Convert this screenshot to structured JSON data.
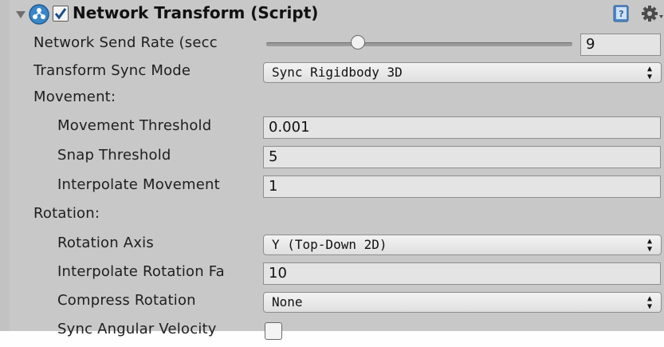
{
  "header": {
    "title": "Network Transform (Script)",
    "enabled": true
  },
  "send_rate": {
    "label": "Network Send Rate (secc",
    "value": "9",
    "slider_fraction": 0.3
  },
  "sync_mode": {
    "label": "Transform Sync Mode",
    "value": "Sync Rigidbody 3D"
  },
  "movement": {
    "heading": "Movement:",
    "threshold_label": "Movement Threshold",
    "threshold_value": "0.001",
    "snap_label": "Snap Threshold",
    "snap_value": "5",
    "interp_label": "Interpolate Movement",
    "interp_value": "1"
  },
  "rotation": {
    "heading": "Rotation:",
    "axis_label": "Rotation Axis",
    "axis_value": "Y (Top-Down 2D)",
    "interp_label": "Interpolate Rotation Fa",
    "interp_value": "10",
    "compress_label": "Compress Rotation",
    "compress_value": "None",
    "angular_label": "Sync Angular Velocity",
    "angular_checked": false
  },
  "colors": {
    "panel": "#c8c8c8",
    "field": "#e4e4e4",
    "component_icon": "#3a86c8"
  },
  "icons": [
    "fold-arrow-icon",
    "network-component-icon",
    "checkmark-icon",
    "help-book-icon",
    "gear-icon",
    "dropdown-arrows-icon"
  ]
}
